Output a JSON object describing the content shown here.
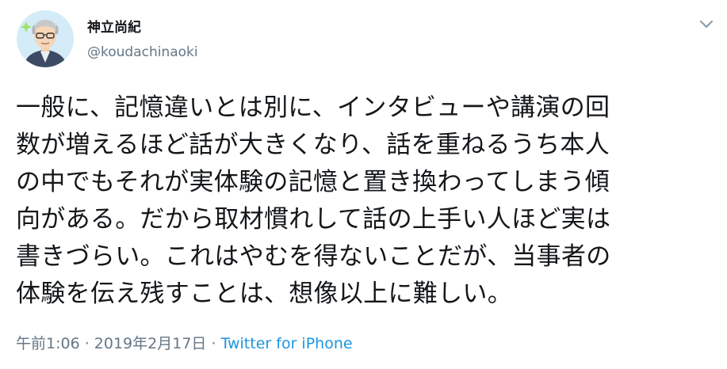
{
  "author": {
    "display_name": "神立尚紀",
    "handle": "@koudachinaoki"
  },
  "tweet": {
    "lines": [
      "一般に、記憶違いとは別に、インタビューや講演の回",
      "数が増えるほど話が大きくなり、話を重ねるうち本人",
      "の中でもそれが実体験の記憶と置き換わってしまう傾",
      "向がある。だから取材慣れして話の上手い人ほど実は",
      "書きづらい。これはやむを得ないことだが、当事者の",
      "体験を伝え残すことは、想像以上に難しい。"
    ]
  },
  "meta": {
    "timestamp": "午前1:06 · 2019年2月17日 · ",
    "source": "Twitter for iPhone"
  },
  "icons": {
    "avatar": "avatar-illustration",
    "menu": "chevron-down-icon"
  },
  "colors": {
    "text": "#14171a",
    "secondary": "#657786",
    "link": "#1b95e0"
  }
}
